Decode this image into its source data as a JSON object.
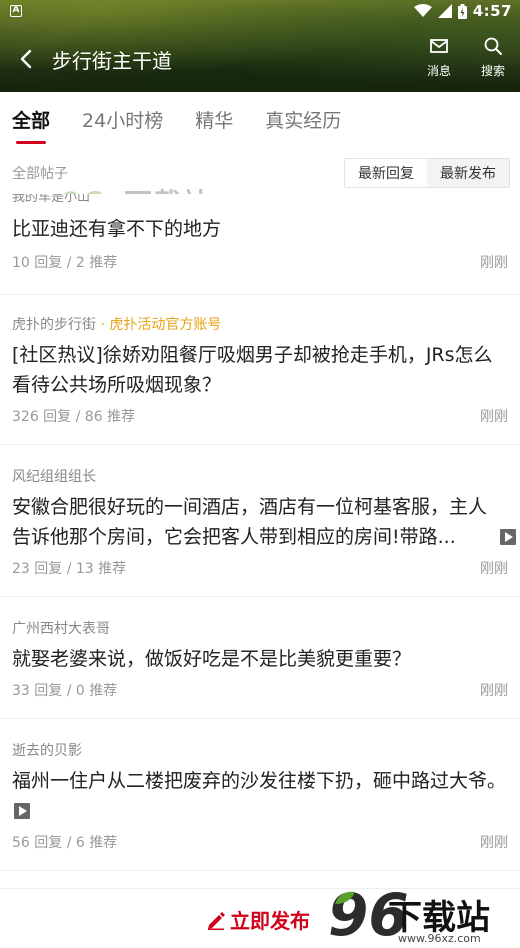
{
  "status_bar": {
    "notification": "A",
    "time": "4:57"
  },
  "nav": {
    "title": "步行街主干道",
    "messages_label": "消息",
    "search_label": "搜索"
  },
  "tabs": [
    {
      "label": "全部",
      "active": true
    },
    {
      "label": "24小时榜",
      "active": false
    },
    {
      "label": "精华",
      "active": false
    },
    {
      "label": "真实经历",
      "active": false
    }
  ],
  "filter": {
    "label": "全部帖子",
    "sort_options": [
      "最新回复",
      "最新发布"
    ]
  },
  "posts": [
    {
      "author": "我的车是小山",
      "badge": "",
      "title": "比亚迪还有拿不下的地方",
      "meta": "10 回复 / 2 推荐",
      "time": "刚刚"
    },
    {
      "author": "虎扑的步行街",
      "badge": " · 虎扑活动官方账号",
      "title": "[社区热议]徐娇劝阻餐厅吸烟男子却被抢走手机，JRs怎么看待公共场所吸烟现象？",
      "meta": "326 回复 / 86 推荐",
      "time": "刚刚"
    },
    {
      "author": "风纪组组组长",
      "badge": "",
      "title": "安徽合肥很好玩的一间酒店，酒店有一位柯基客服，主人告诉他那个房间，它会把客人带到相应的房间!带路...",
      "meta": "23 回复 / 13 推荐",
      "time": "刚刚"
    },
    {
      "author": "广州西村大表哥",
      "badge": "",
      "title": "就娶老婆来说，做饭好吃是不是比美貌更重要？",
      "meta": "33 回复 / 0 推荐",
      "time": "刚刚"
    },
    {
      "author": "逝去的贝影",
      "badge": "",
      "title": "福州一住户从二楼把废弃的沙发往楼下扔，砸中路过大爷。",
      "meta": "56 回复 / 6 推荐",
      "time": "刚刚"
    }
  ],
  "bottom": {
    "publish_label": "立即发布"
  },
  "watermark": {
    "top_text": "下载站",
    "brand_digits": "96",
    "brand_text": "下载站",
    "url": "www.96xz.com"
  },
  "colors": {
    "accent": "#d0021b",
    "badge": "#e8a317"
  }
}
